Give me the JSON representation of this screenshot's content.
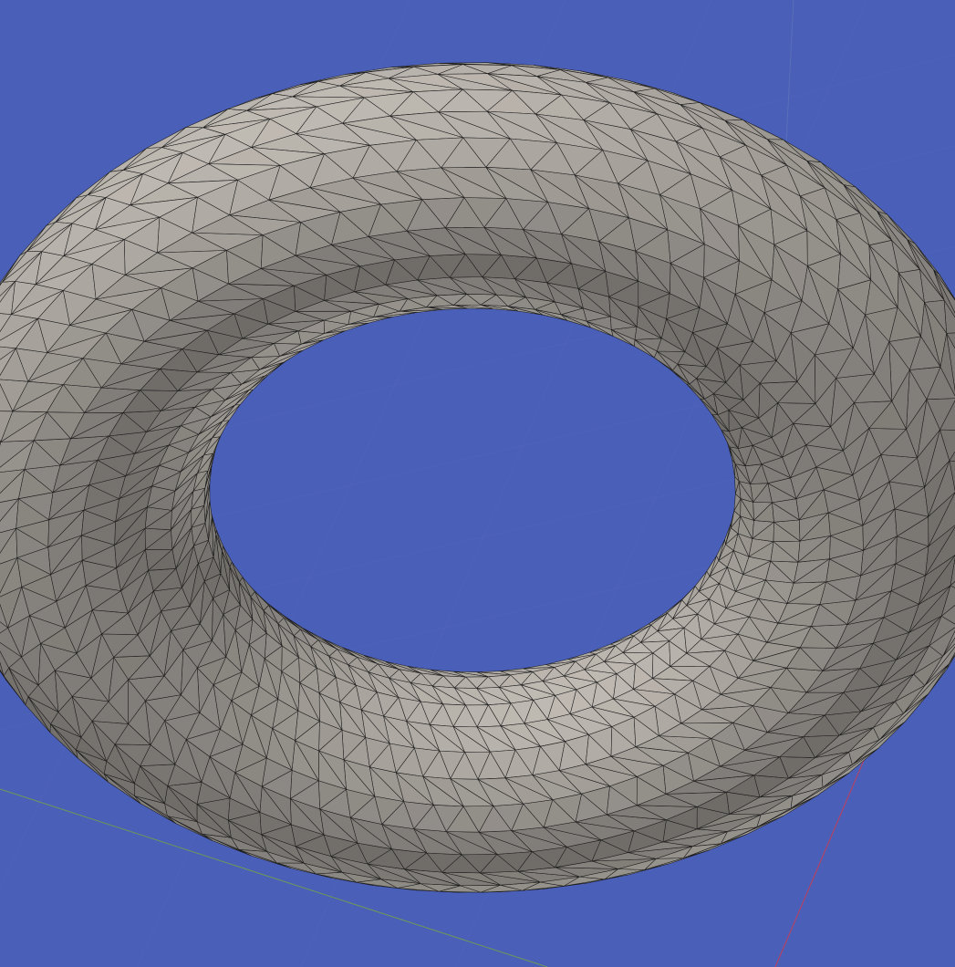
{
  "viewport": {
    "background_color": "#4a5fb8",
    "grid_visible": true,
    "grid_color": "#5566bf",
    "axes": {
      "x_axis_color": "#c0405a",
      "y_axis_color": "#6e9a55",
      "z_axis_color": "#5a70b8"
    },
    "object": {
      "shape": "torus",
      "display_mode": "shaded-with-wireframe",
      "surface_color": "#b3aea7",
      "wire_color": "#1c1c1c",
      "major_segments": 72,
      "minor_segments": 26
    }
  }
}
